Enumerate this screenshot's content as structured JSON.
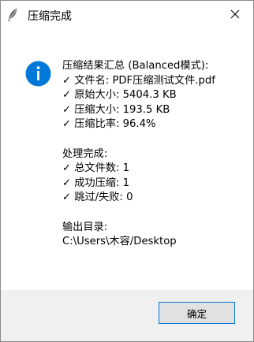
{
  "window": {
    "title": "压缩完成",
    "title_icon": "feather-icon",
    "close_icon": "close-icon"
  },
  "message": {
    "icon": "info-icon",
    "summary_header": "压缩结果汇总 (Balanced模式):",
    "summary_lines": [
      "✓ 文件名: PDF压缩测试文件.pdf",
      "✓ 原始大小: 5404.3 KB",
      "✓ 压缩大小: 193.5 KB",
      "✓ 压缩比率: 96.4%"
    ],
    "processing_header": "处理完成:",
    "processing_lines": [
      "✓ 总文件数: 1",
      "✓ 成功压缩: 1",
      "✓ 跳过/失败: 0"
    ],
    "output_header": "输出目录:",
    "output_path": "C:\\Users\\木容/Desktop"
  },
  "footer": {
    "ok_label": "确定"
  },
  "colors": {
    "info_blue": "#0078d7",
    "footer_bg": "#f0f0f0",
    "button_border": "#0078d7",
    "button_bg": "#e1e1e1"
  }
}
